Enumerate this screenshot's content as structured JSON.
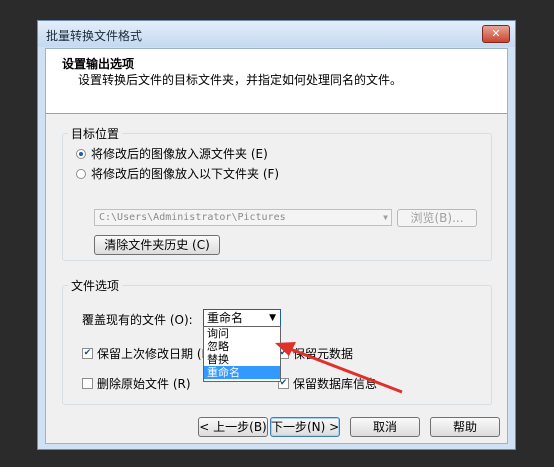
{
  "window": {
    "title": "批量转换文件格式",
    "close_glyph": "✕"
  },
  "header": {
    "title": "设置输出选项",
    "subtitle": "设置转换后文件的目标文件夹，并指定如何处理同名的文件。"
  },
  "target_location": {
    "legend": "目标位置",
    "radio_source": "将修改后的图像放入源文件夹 (E)",
    "radio_other": "将修改后的图像放入以下文件夹 (F)",
    "selected": "radio_source",
    "path_value": "C:\\Users\\Administrator\\Pictures",
    "browse_label": "浏览(B)...",
    "clear_history_label": "清除文件夹历史 (C)"
  },
  "file_options": {
    "legend": "文件选项",
    "overwrite_label": "覆盖现有的文件 (O):",
    "overwrite_selected": "重命名",
    "overwrite_options": [
      "询问",
      "忽略",
      "替换",
      "重命名"
    ],
    "keep_date_label": "保留上次修改日期 (L)",
    "keep_metadata_label": "保留元数据",
    "delete_original_label": "删除原始文件 (R)",
    "keep_db_label": "保留数据库信息",
    "keep_date_checked": true,
    "keep_metadata_checked": true,
    "delete_original_checked": false,
    "keep_db_checked": true,
    "check_glyph": "✔"
  },
  "footer": {
    "back_label": "< 上一步(B)",
    "next_label": "下一步(N) >",
    "cancel_label": "取消",
    "help_label": "帮助"
  },
  "annotation": {
    "arrow_color": "#e0302a"
  }
}
